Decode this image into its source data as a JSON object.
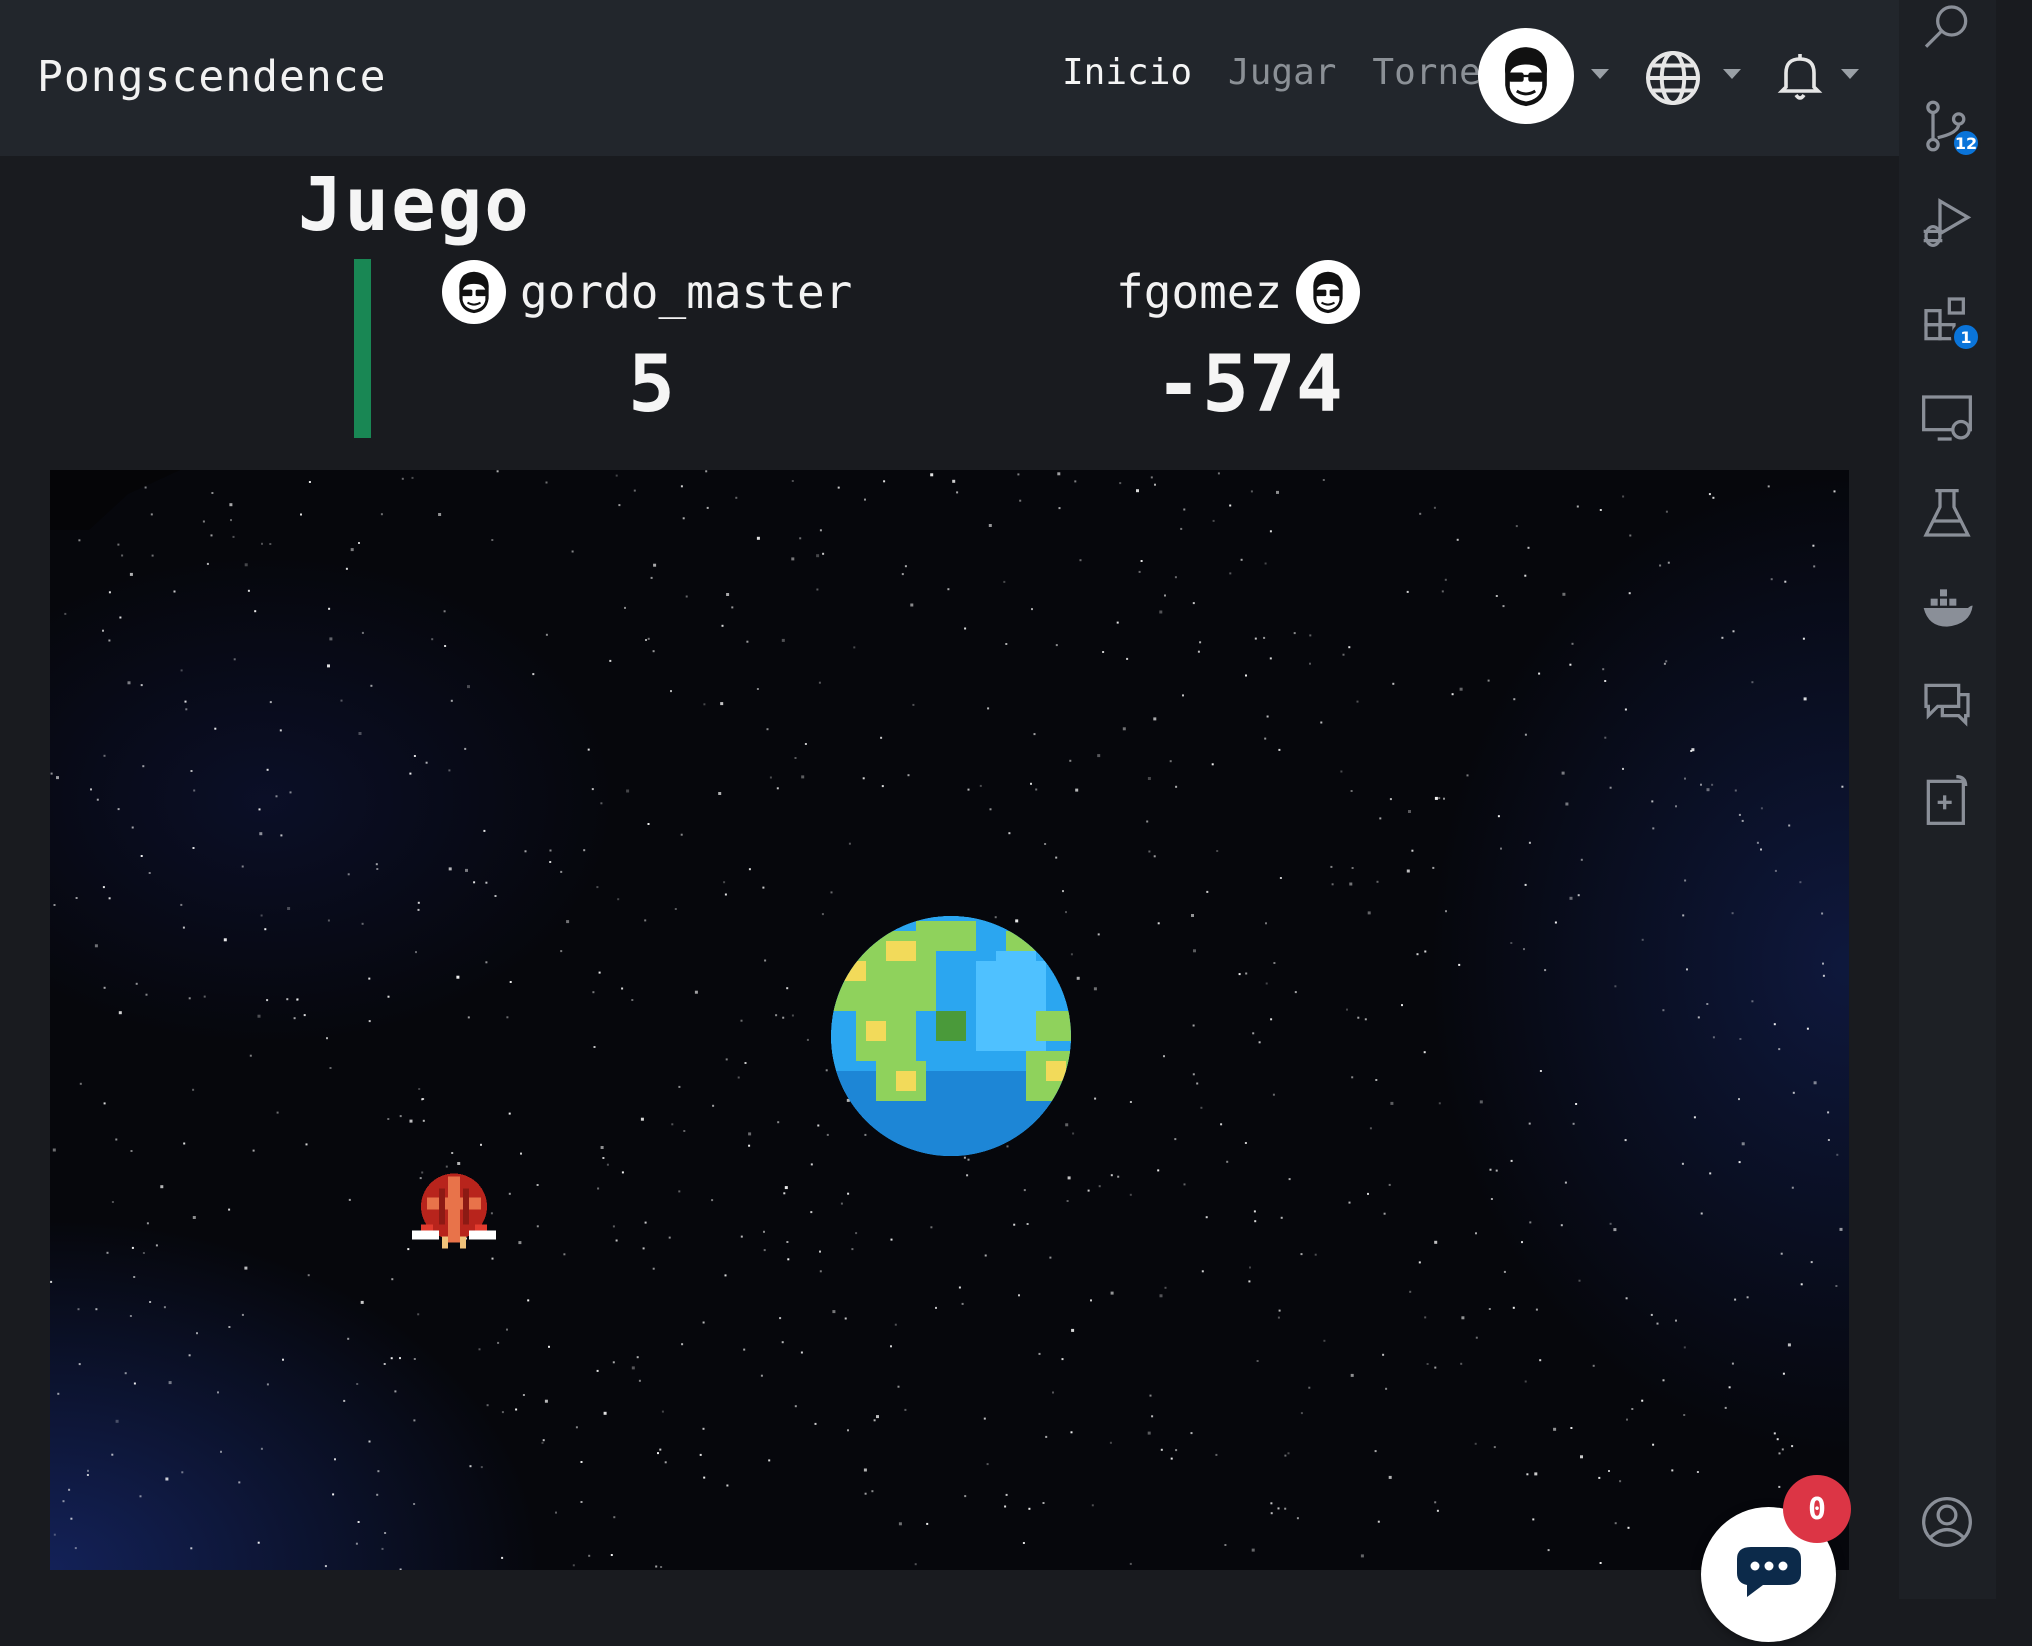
{
  "navbar": {
    "brand": "Pongscendence",
    "links": [
      {
        "label": "Inicio",
        "active": true
      },
      {
        "label": "Jugar",
        "active": false
      },
      {
        "label": "Torneo",
        "active": false
      }
    ],
    "icons": [
      "avatar-icon",
      "globe-icon",
      "bell-icon"
    ]
  },
  "game": {
    "title": "Juego",
    "player1": {
      "name": "gordo_master",
      "score": "5"
    },
    "player2": {
      "name": "fgomez",
      "score": "-574"
    },
    "turn_indicator_color": "#198754"
  },
  "chat": {
    "unread": "0",
    "badge_color": "#dc3545"
  },
  "activity_bar": {
    "items": [
      {
        "name": "search-icon"
      },
      {
        "name": "source-control-icon",
        "badge": "12"
      },
      {
        "name": "run-debug-icon"
      },
      {
        "name": "extensions-icon",
        "badge": "1"
      },
      {
        "name": "remote-explorer-icon"
      },
      {
        "name": "testing-icon"
      },
      {
        "name": "docker-icon"
      },
      {
        "name": "chat-icon"
      },
      {
        "name": "clipboard-icon"
      },
      {
        "name": "account-icon"
      }
    ],
    "badge_color": "#0a74d9"
  }
}
